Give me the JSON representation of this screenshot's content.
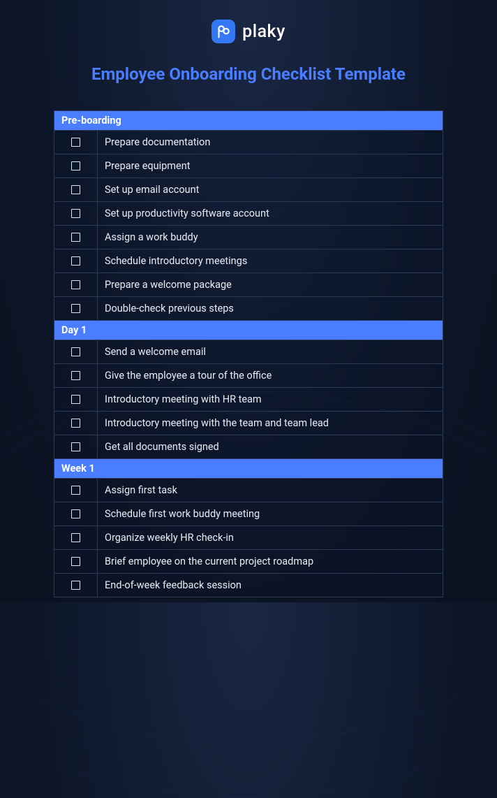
{
  "brand": {
    "name": "plaky"
  },
  "title": "Employee Onboarding Checklist Template",
  "sections": [
    {
      "heading": "Pre-boarding",
      "items": [
        "Prepare documentation",
        "Prepare equipment",
        "Set up email account",
        "Set up productivity software account",
        "Assign a work buddy",
        "Schedule introductory meetings",
        "Prepare a welcome package",
        "Double-check previous steps"
      ]
    },
    {
      "heading": "Day 1",
      "items": [
        "Send a welcome email",
        "Give the employee a tour of the office",
        "Introductory meeting with HR team",
        "Introductory meeting with the team and team lead",
        "Get all documents signed"
      ]
    },
    {
      "heading": "Week 1",
      "items": [
        "Assign first task",
        "Schedule first work buddy meeting",
        "Organize weekly HR check-in",
        "Brief employee on the current project roadmap",
        "End-of-week feedback session"
      ]
    }
  ]
}
